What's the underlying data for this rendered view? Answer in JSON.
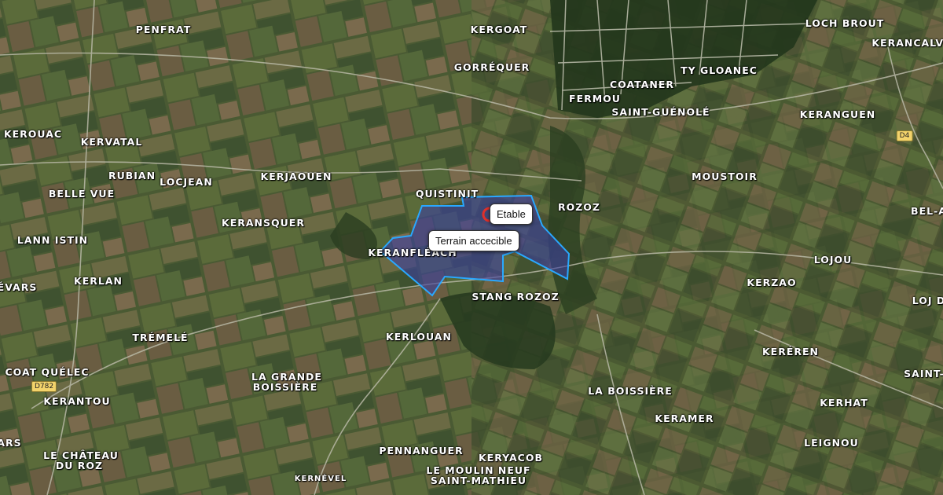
{
  "places": [
    {
      "id": "penfrat",
      "name": "PENFRAT"
    },
    {
      "id": "kergoat",
      "name": "KERGOAT"
    },
    {
      "id": "loch-brout",
      "name": "LOCH BROUT"
    },
    {
      "id": "kerancalve",
      "name": "KERANCALVE"
    },
    {
      "id": "gorrequer",
      "name": "GORRÉQUER"
    },
    {
      "id": "coataner",
      "name": "COATANER"
    },
    {
      "id": "ty-gloanec",
      "name": "TY GLOANEC"
    },
    {
      "id": "fermou",
      "name": "FERMOU"
    },
    {
      "id": "saint-guenole",
      "name": "SAINT-GUÉNOLÉ"
    },
    {
      "id": "kerouac",
      "name": "KEROUAC"
    },
    {
      "id": "kervatal",
      "name": "KERVATAL"
    },
    {
      "id": "keranguen",
      "name": "KERANGUEN"
    },
    {
      "id": "rubian",
      "name": "RUBIAN"
    },
    {
      "id": "locjean",
      "name": "LOCJEAN"
    },
    {
      "id": "kerjaouen",
      "name": "KERJAOUEN"
    },
    {
      "id": "moustoir",
      "name": "MOUSTOIR"
    },
    {
      "id": "belle-vue",
      "name": "BELLE VUE"
    },
    {
      "id": "quistinit",
      "name": "QUISTINIT"
    },
    {
      "id": "rozoz",
      "name": "ROZOZ"
    },
    {
      "id": "bel-a",
      "name": "BEL-A"
    },
    {
      "id": "keransquer",
      "name": "KERANSQUER"
    },
    {
      "id": "lann-istin",
      "name": "LANN ISTIN"
    },
    {
      "id": "keranfleach",
      "name": "KERANFLÉACH"
    },
    {
      "id": "lojou",
      "name": "LOJOU"
    },
    {
      "id": "kerlan",
      "name": "KERLAN"
    },
    {
      "id": "evars",
      "name": "ÉVARS"
    },
    {
      "id": "kerzao",
      "name": "KERZAO"
    },
    {
      "id": "stang-rozoz",
      "name": "STANG ROZOZ"
    },
    {
      "id": "loj-d",
      "name": "LOJ D"
    },
    {
      "id": "tremele",
      "name": "TRÉMELÉ"
    },
    {
      "id": "kerlouan",
      "name": "KERLOUAN"
    },
    {
      "id": "kereren",
      "name": "KERÉREN"
    },
    {
      "id": "coat-quelec",
      "name": "COAT QUÉLEC"
    },
    {
      "id": "saint",
      "name": "SAINT-"
    },
    {
      "id": "la-grande",
      "name": "LA GRANDE"
    },
    {
      "id": "boissiere",
      "name": "BOISSIÈRE"
    },
    {
      "id": "kerantou",
      "name": "KERANTOU"
    },
    {
      "id": "la-boissiere",
      "name": "LA BOISSIÈRE"
    },
    {
      "id": "kerhat",
      "name": "KERHAT"
    },
    {
      "id": "keramer",
      "name": "KERAMER"
    },
    {
      "id": "ars",
      "name": "ARS"
    },
    {
      "id": "le-chateau",
      "name": "LE CHÂTEAU"
    },
    {
      "id": "du-roz",
      "name": "DU ROZ"
    },
    {
      "id": "pennanguer",
      "name": "PENNANGUER"
    },
    {
      "id": "keryacob",
      "name": "KERYACOB"
    },
    {
      "id": "leignou",
      "name": "LEIGNOU"
    },
    {
      "id": "kernevel",
      "name": "KERNÉVEL"
    },
    {
      "id": "le-moulin-neuf",
      "name": "LE MOULIN NEUF"
    },
    {
      "id": "saint-mathieu",
      "name": "SAINT-MATHIEU"
    }
  ],
  "roads": [
    {
      "id": "d4",
      "label": "D4"
    },
    {
      "id": "d782",
      "label": "D782"
    }
  ],
  "popups": {
    "etable": "Etable",
    "terrain": "Terrain accecible"
  },
  "colors": {
    "parcel_fill": "#3a3fa0",
    "parcel_stroke": "#29a8ff",
    "marker": "#e0302a"
  }
}
